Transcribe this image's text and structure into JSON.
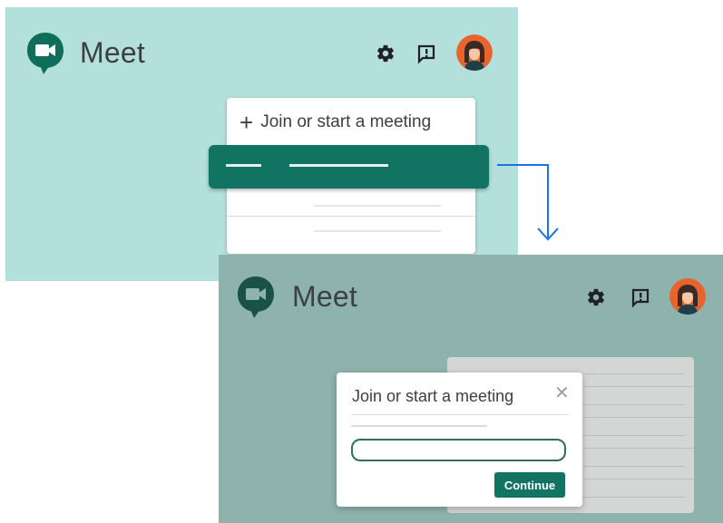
{
  "top_screen": {
    "app_name": "Meet",
    "header_icons": [
      "settings-icon",
      "feedback-icon",
      "avatar"
    ],
    "menu": {
      "join_icon": "plus-icon",
      "join_label": "Join or start a meeting",
      "highlighted_item": "selected-menu-item"
    }
  },
  "connector": {
    "icon": "arrow-down-icon"
  },
  "bottom_screen": {
    "app_name": "Meet",
    "header_icons": [
      "settings-icon",
      "feedback-icon",
      "avatar"
    ],
    "dialog": {
      "title": "Join or start a meeting",
      "close_symbol": "✕",
      "input_value": "",
      "continue_label": "Continue"
    }
  },
  "colors": {
    "top_background": "#b4e0dc",
    "bottom_background": "#8eb3ad",
    "accent": "#117463",
    "arrow": "#1a73e8"
  }
}
